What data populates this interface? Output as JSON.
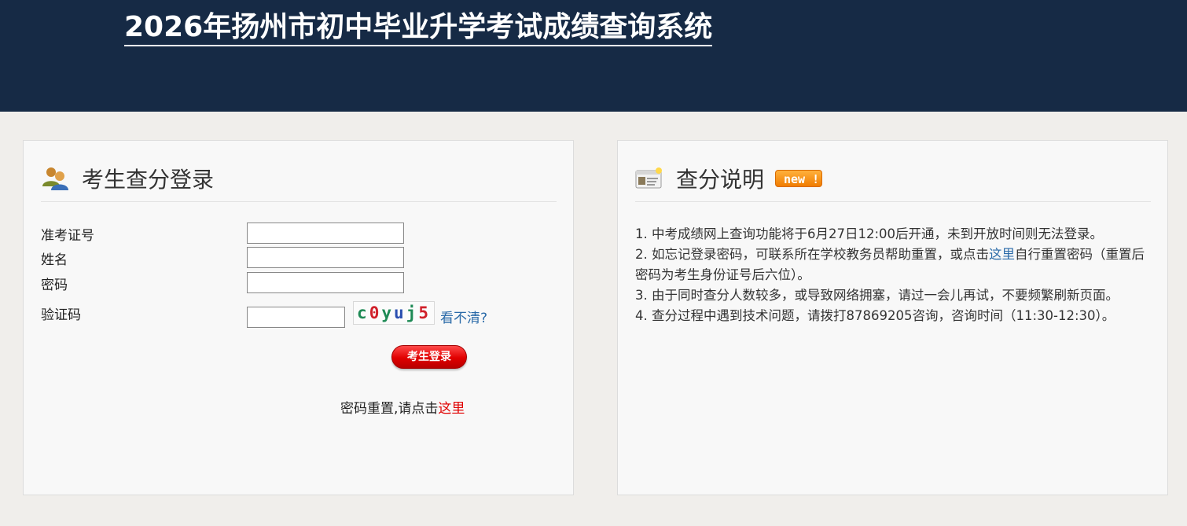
{
  "header": {
    "title": "2026年扬州市初中毕业升学考试成绩查询系统"
  },
  "login": {
    "title": "考生查分登录",
    "fields": {
      "exam_id_label": "准考证号",
      "name_label": "姓名",
      "password_label": "密码",
      "captcha_label": "验证码"
    },
    "captcha_chars": [
      "c",
      "0",
      "y",
      "u",
      "j",
      "5"
    ],
    "captcha_colors": [
      "#1e8a55",
      "#d0202a",
      "#1e8a55",
      "#2a4fb0",
      "#1e8a55",
      "#d0202a"
    ],
    "refresh_label": "看不清?",
    "login_button": "考生登录",
    "reset_text": "密码重置,请点击",
    "reset_link": "这里"
  },
  "info": {
    "title": "查分说明",
    "badge": "new !",
    "notes": {
      "n1": "1. 中考成绩网上查询功能将于6月27日12:00后开通，未到开放时间则无法登录。",
      "n2_pre": "2. 如忘记登录密码，可联系所在学校教务员帮助重置，或点击",
      "n2_link": "这里",
      "n2_post": "自行重置密码（重置后密码为考生身份证号后六位）。",
      "n3": "3. 由于同时查分人数较多，或导致网络拥塞，请过一会儿再试，不要频繁刷新页面。",
      "n4": "4. 查分过程中遇到技术问题，请拨打87869205咨询，咨询时间（11:30-12:30）。"
    }
  },
  "colors": {
    "header_bg": "#162a45",
    "page_bg": "#f0eeeb",
    "link_blue": "#2a6aa8",
    "link_red": "#e00000"
  }
}
